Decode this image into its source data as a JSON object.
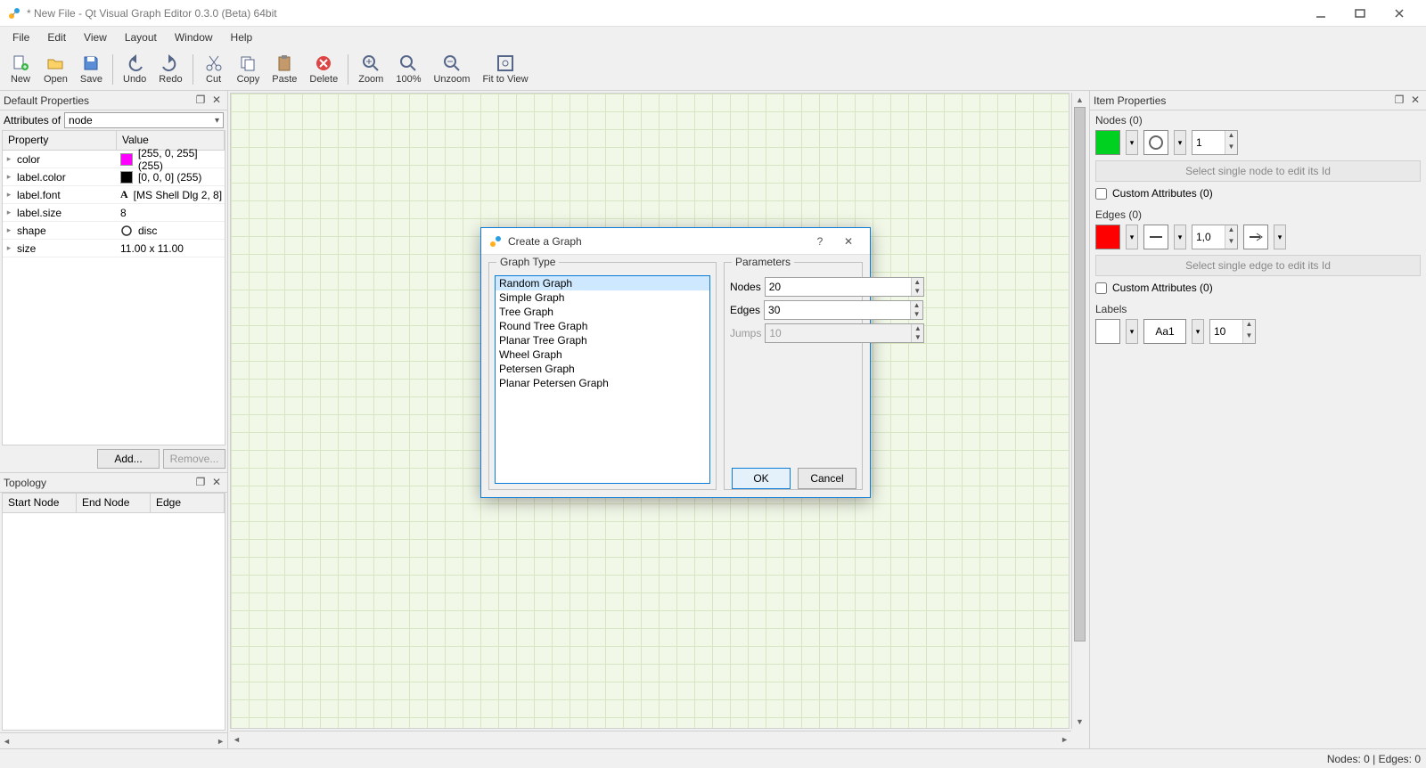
{
  "window": {
    "title": "* New File - Qt Visual Graph Editor 0.3.0 (Beta) 64bit"
  },
  "menu": {
    "items": [
      "File",
      "Edit",
      "View",
      "Layout",
      "Window",
      "Help"
    ]
  },
  "toolbar": {
    "new": "New",
    "open": "Open",
    "save": "Save",
    "undo": "Undo",
    "redo": "Redo",
    "cut": "Cut",
    "copy": "Copy",
    "paste": "Paste",
    "delete": "Delete",
    "zoom": "Zoom",
    "zoom100": "100%",
    "unzoom": "Unzoom",
    "fit": "Fit to View"
  },
  "leftPanel": {
    "title": "Default Properties",
    "attrLabel": "Attributes of",
    "attrValue": "node",
    "headers": {
      "property": "Property",
      "value": "Value"
    },
    "rows": [
      {
        "name": "color",
        "value": "[255, 0, 255] (255)",
        "swatch": "#ff00ff"
      },
      {
        "name": "label.color",
        "value": "[0, 0, 0] (255)",
        "swatch": "#000000"
      },
      {
        "name": "label.font",
        "value": "[MS Shell Dlg 2, 8]",
        "glyph": "A"
      },
      {
        "name": "label.size",
        "value": "8"
      },
      {
        "name": "shape",
        "value": "disc",
        "circle": true
      },
      {
        "name": "size",
        "value": "11.00 x 11.00"
      }
    ],
    "addBtn": "Add...",
    "removeBtn": "Remove..."
  },
  "topology": {
    "title": "Topology",
    "headers": {
      "start": "Start Node",
      "end": "End Node",
      "edge": "Edge"
    }
  },
  "dialog": {
    "title": "Create a Graph",
    "graphTypeLabel": "Graph Type",
    "parametersLabel": "Parameters",
    "types": [
      "Random Graph",
      "Simple Graph",
      "Tree Graph",
      "Round Tree Graph",
      "Planar Tree Graph",
      "Wheel Graph",
      "Petersen Graph",
      "Planar Petersen Graph"
    ],
    "selectedIndex": 0,
    "params": {
      "nodesLabel": "Nodes",
      "nodesValue": "20",
      "edgesLabel": "Edges",
      "edgesValue": "30",
      "jumpsLabel": "Jumps",
      "jumpsValue": "10",
      "jumpsDisabled": true
    },
    "ok": "OK",
    "cancel": "Cancel"
  },
  "rightPanel": {
    "title": "Item Properties",
    "nodesTitle": "Nodes (0)",
    "nodeColor": "#00d020",
    "nodeStroke": "1",
    "nodeHint": "Select single node to edit its Id",
    "nodeCustom": "Custom Attributes (0)",
    "edgesTitle": "Edges (0)",
    "edgeColor": "#ff0000",
    "edgeWeight": "1,0",
    "edgeHint": "Select single edge to edit its Id",
    "edgeCustom": "Custom Attributes (0)",
    "labelsTitle": "Labels",
    "labelColor": "#ffffff",
    "fontSample": "Aa1",
    "fontSize": "10"
  },
  "status": {
    "text": "Nodes: 0 | Edges: 0"
  }
}
